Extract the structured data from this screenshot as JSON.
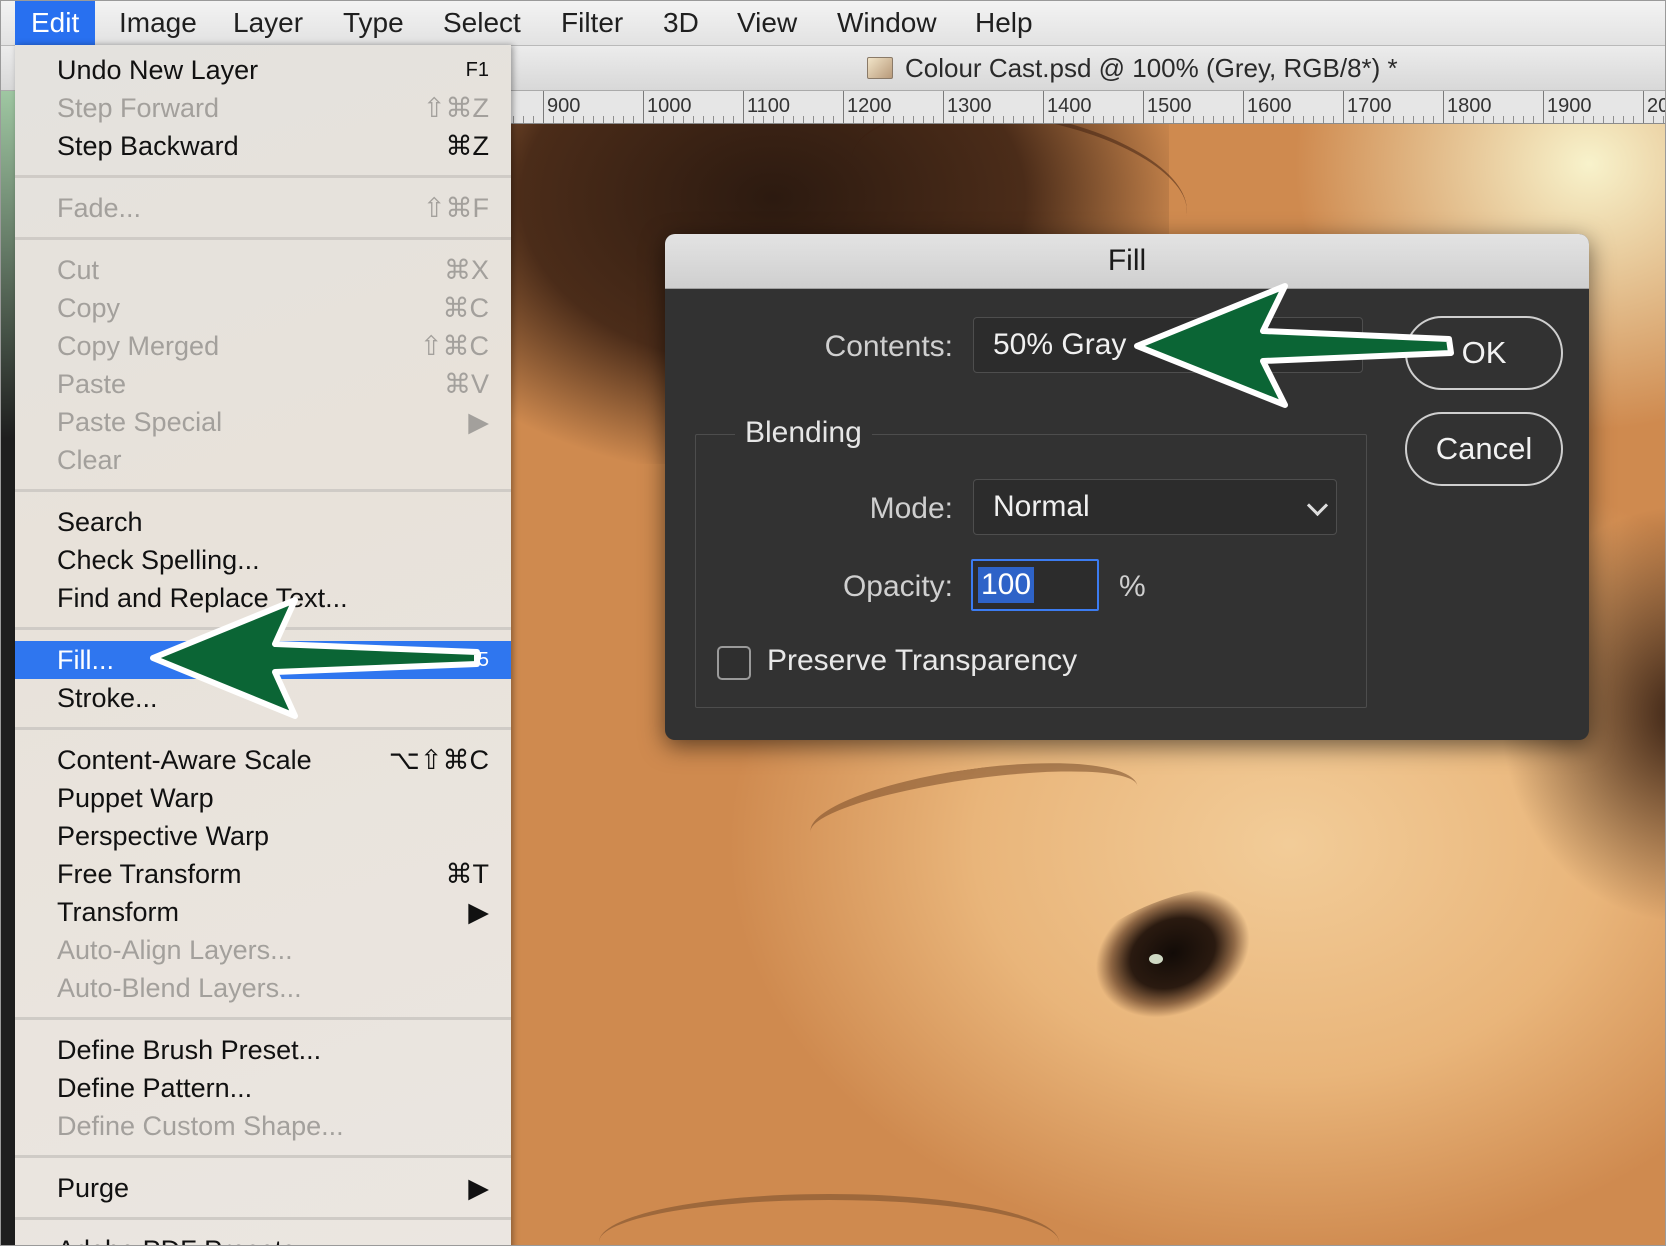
{
  "menubar": {
    "items": [
      "Edit",
      "Image",
      "Layer",
      "Type",
      "Select",
      "Filter",
      "3D",
      "View",
      "Window",
      "Help"
    ]
  },
  "document": {
    "title": "Colour Cast.psd @ 100% (Grey, RGB/8*) *",
    "ruler_labels": [
      "900",
      "1000",
      "1100",
      "1200",
      "1300",
      "1400",
      "1500",
      "1600",
      "1700",
      "1800",
      "1900",
      "20"
    ]
  },
  "edit_menu": {
    "undo": {
      "label": "Undo New Layer",
      "shortcut": "F1"
    },
    "step_forward": {
      "label": "Step Forward",
      "shortcut": "⇧⌘Z"
    },
    "step_backward": {
      "label": "Step Backward",
      "shortcut": "⌘Z"
    },
    "fade": {
      "label": "Fade...",
      "shortcut": "⇧⌘F"
    },
    "cut": {
      "label": "Cut",
      "shortcut": "⌘X"
    },
    "copy": {
      "label": "Copy",
      "shortcut": "⌘C"
    },
    "copy_merged": {
      "label": "Copy Merged",
      "shortcut": "⇧⌘C"
    },
    "paste": {
      "label": "Paste",
      "shortcut": "⌘V"
    },
    "paste_special": {
      "label": "Paste Special",
      "shortcut": "▶"
    },
    "clear": {
      "label": "Clear"
    },
    "search": {
      "label": "Search"
    },
    "check_spelling": {
      "label": "Check Spelling..."
    },
    "find_replace": {
      "label": "Find and Replace Text..."
    },
    "fill": {
      "label": "Fill...",
      "shortcut": "F5"
    },
    "stroke": {
      "label": "Stroke..."
    },
    "content_aware_scale": {
      "label": "Content-Aware Scale",
      "shortcut": "⌥⇧⌘C"
    },
    "puppet_warp": {
      "label": "Puppet Warp"
    },
    "perspective_warp": {
      "label": "Perspective Warp"
    },
    "free_transform": {
      "label": "Free Transform",
      "shortcut": "⌘T"
    },
    "transform": {
      "label": "Transform",
      "shortcut": "▶"
    },
    "auto_align": {
      "label": "Auto-Align Layers..."
    },
    "auto_blend": {
      "label": "Auto-Blend Layers..."
    },
    "define_brush": {
      "label": "Define Brush Preset..."
    },
    "define_pattern": {
      "label": "Define Pattern..."
    },
    "define_shape": {
      "label": "Define Custom Shape..."
    },
    "purge": {
      "label": "Purge",
      "shortcut": "▶"
    },
    "adobe_pdf_presets": {
      "label": "Adobe PDF Presets..."
    }
  },
  "fill_dialog": {
    "title": "Fill",
    "contents_label": "Contents:",
    "contents_value": "50% Gray",
    "blending_label": "Blending",
    "mode_label": "Mode:",
    "mode_value": "Normal",
    "opacity_label": "Opacity:",
    "opacity_value": "100",
    "opacity_unit": "%",
    "preserve_transparency_label": "Preserve Transparency",
    "preserve_transparency_checked": false,
    "ok_label": "OK",
    "cancel_label": "Cancel"
  },
  "colors": {
    "menu_highlight": "#2f76ef",
    "annotation_arrow": "#0b6535",
    "dialog_bg": "#323232"
  }
}
